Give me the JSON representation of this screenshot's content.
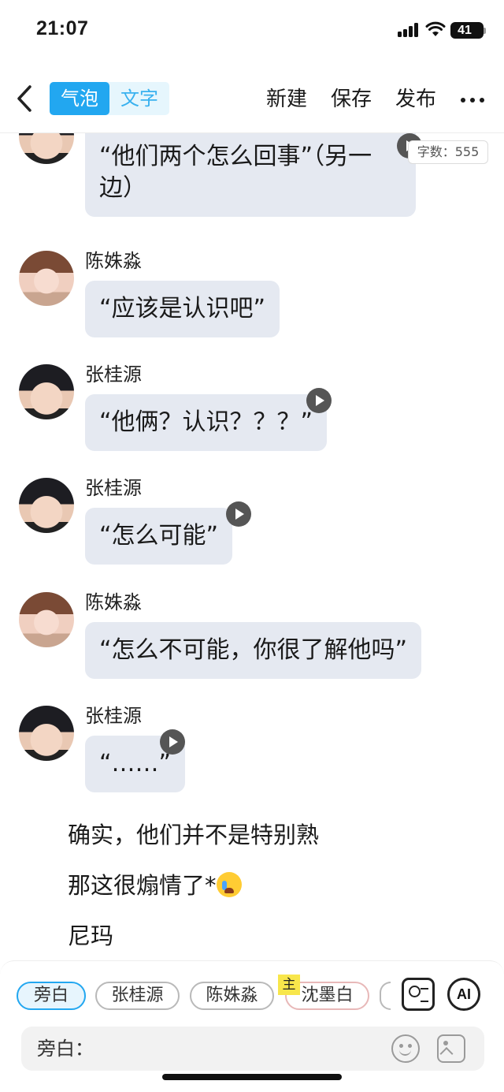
{
  "status_bar": {
    "time": "21:07",
    "battery": "41"
  },
  "nav": {
    "tab_bubble": "气泡",
    "tab_text": "文字",
    "new": "新建",
    "save": "保存",
    "publish": "发布"
  },
  "word_count": "字数：555",
  "messages": [
    {
      "text": "“他们两个怎么回事”（另一边）"
    },
    {
      "sender": "陈姝淼",
      "text": "“应该是认识吧”"
    },
    {
      "sender": "张桂源",
      "text": "“他俩？认识？？？”"
    },
    {
      "sender": "张桂源",
      "text": "“怎么可能”"
    },
    {
      "sender": "陈姝淼",
      "text": "“怎么不可能，你很了解他吗”"
    },
    {
      "sender": "张桂源",
      "text": "“……”"
    }
  ],
  "narration": [
    "确实，他们并不是特别熟",
    "那这很煽情了*",
    "尼玛"
  ],
  "roles": {
    "items": [
      "旁白",
      "张桂源",
      "陈姝淼",
      "沈墨白"
    ],
    "main_badge": "主",
    "ai": "AI"
  },
  "input": {
    "label": "旁白："
  }
}
